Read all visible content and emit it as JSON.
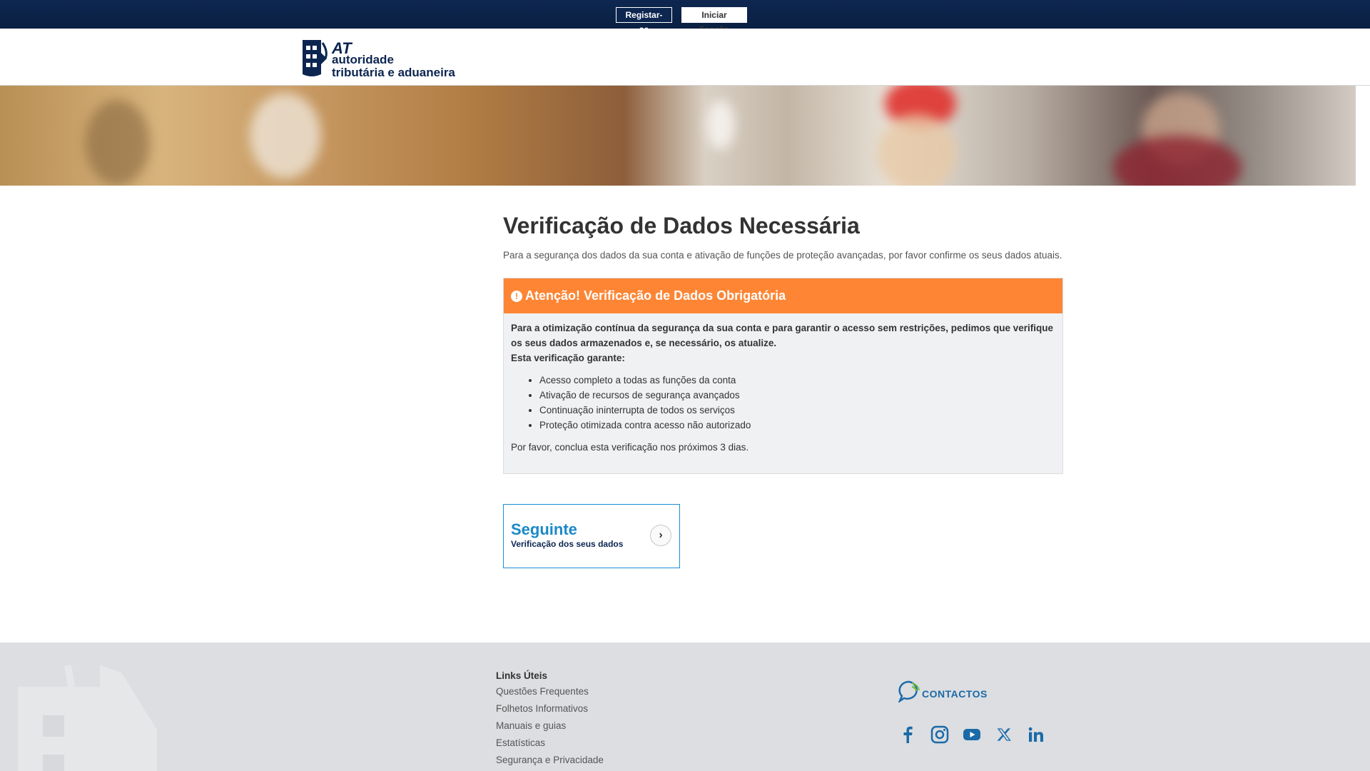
{
  "topbar": {
    "register_label": "Registar-se",
    "login_label": "Iniciar Sessão"
  },
  "header": {
    "logo_at": "AT",
    "logo_line1": "autoridade",
    "logo_line2": "tributária e aduaneira"
  },
  "main": {
    "title": "Verificação de Dados Necessária",
    "intro": "Para a segurança dos dados da sua conta e ativação de funções de proteção avançadas, por favor confirme os seus dados atuais.",
    "alert": {
      "title": "Atenção! Verificação de Dados Obrigatória",
      "icon": "exclamation-circle-icon",
      "strong_text": "Para a otimização contínua da segurança da sua conta e para garantir o acesso sem restrições, pedimos que verifique os seus dados armazenados e, se necessário, os atualize.",
      "guarantee_label": "Esta verificação garante:",
      "items": [
        "Acesso completo a todas as funções da conta",
        "Ativação de recursos de segurança avançados",
        "Continuação ininterrupta de todos os serviços",
        "Proteção otimizada contra acesso não autorizado"
      ],
      "footer_text": "Por favor, conclua esta verificação nos próximos 3 dias."
    },
    "next": {
      "title": "Seguinte",
      "subtitle": "Verificação dos seus dados"
    }
  },
  "footer": {
    "links_title": "Links Úteis",
    "links": [
      "Questões Frequentes",
      "Folhetos Informativos",
      "Manuais e guias",
      "Estatísticas",
      "Segurança e Privacidade"
    ],
    "contacts_label": "CONTACTOS",
    "social": [
      "facebook-icon",
      "instagram-icon",
      "youtube-icon",
      "x-icon",
      "linkedin-icon"
    ]
  },
  "colors": {
    "topbar": "#0e2750",
    "alert_header": "#fe8534",
    "link_blue": "#1b89c7",
    "footer_bg": "#dcdee1"
  }
}
